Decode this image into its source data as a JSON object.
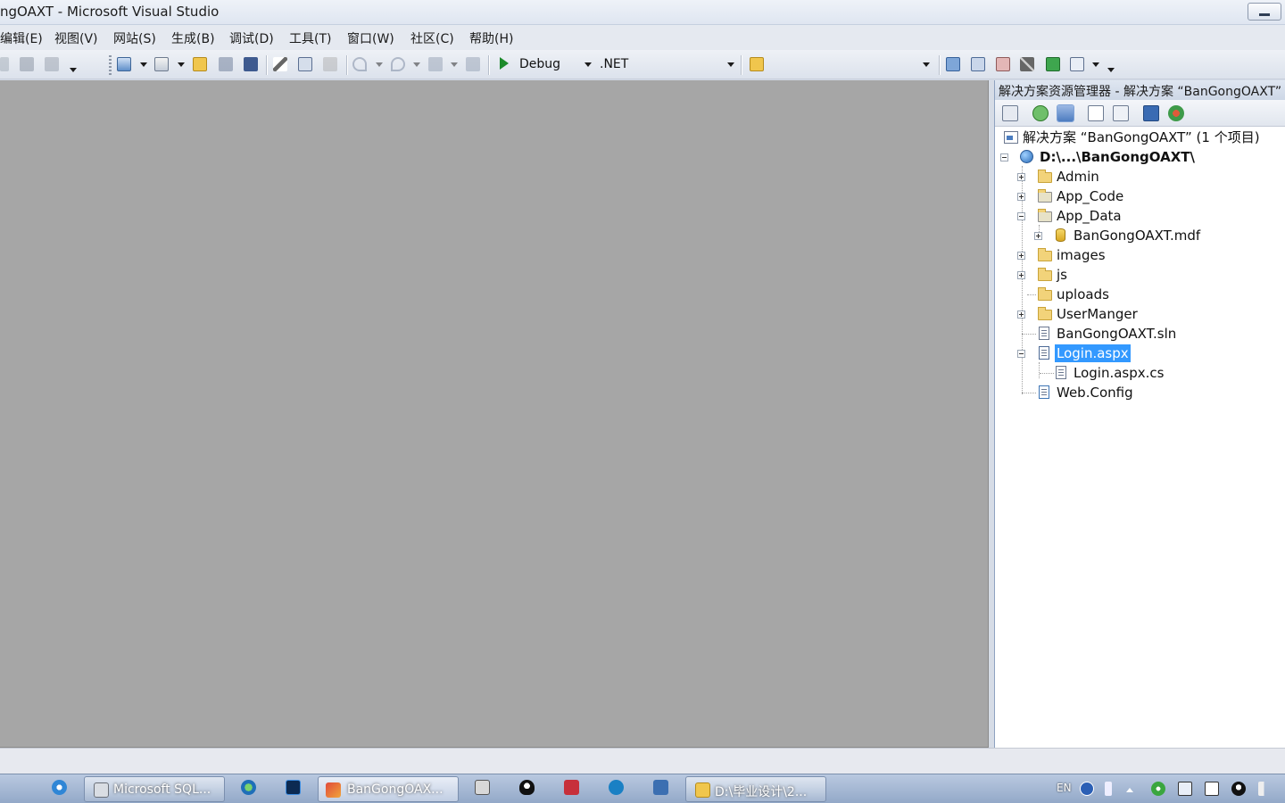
{
  "window": {
    "title": "ngOAXT - Microsoft Visual Studio"
  },
  "menu": [
    {
      "label": "编辑(E)"
    },
    {
      "label": "视图(V)"
    },
    {
      "label": "网站(S)"
    },
    {
      "label": "生成(B)"
    },
    {
      "label": "调试(D)"
    },
    {
      "label": "工具(T)"
    },
    {
      "label": "窗口(W)"
    },
    {
      "label": "社区(C)"
    },
    {
      "label": "帮助(H)"
    }
  ],
  "toolbar": {
    "config": "Debug",
    "platform": ".NET"
  },
  "solution_explorer": {
    "title": "解决方案资源管理器 - 解决方案 “BanGongOAXT”",
    "solution_label": "解决方案 “BanGongOAXT” (1 个项目)",
    "project_label": "D:\\...\\BanGongOAXT\\",
    "items": [
      {
        "label": "Admin"
      },
      {
        "label": "App_Code"
      },
      {
        "label": "App_Data"
      },
      {
        "label": "BanGongOAXT.mdf"
      },
      {
        "label": "images"
      },
      {
        "label": "js"
      },
      {
        "label": "uploads"
      },
      {
        "label": "UserManger"
      },
      {
        "label": "BanGongOAXT.sln"
      },
      {
        "label": "Login.aspx"
      },
      {
        "label": "Login.aspx.cs"
      },
      {
        "label": "Web.Config"
      }
    ]
  },
  "taskbar": {
    "tasks": [
      {
        "label": "Microsoft SQL..."
      },
      {
        "label": "BanGongOAX..."
      },
      {
        "label": "D:\\毕业设计\\2..."
      }
    ],
    "tray_language": "EN"
  },
  "colors": {
    "editor_bg": "#a6a6a6",
    "selection": "#3399ff",
    "taskbar": "#a7bad6"
  }
}
